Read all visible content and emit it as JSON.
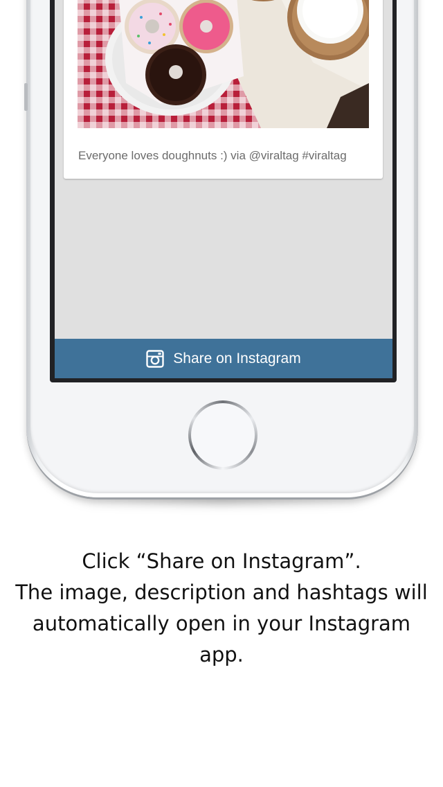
{
  "card": {
    "caption": "Everyone loves doughnuts :) via @viraltag #viraltag"
  },
  "share_button": {
    "label": "Share on Instagram",
    "icon": "instagram-camera-icon",
    "color": "#3f7299"
  },
  "description": {
    "lines": [
      "Click “Share on Instagram”.",
      "The image, description and hashtags will",
      "automatically open in your Instagram",
      "app."
    ]
  }
}
